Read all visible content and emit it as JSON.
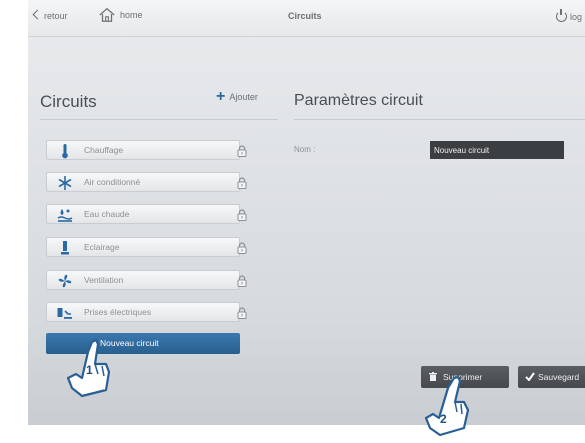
{
  "topbar": {
    "back_label": "retour",
    "home_label": "home",
    "title": "Circuits",
    "logout_label": "log"
  },
  "left": {
    "heading": "Circuits",
    "add_label": "Ajouter",
    "circuits": [
      {
        "label": "Chauffage",
        "icon": "thermometer-icon"
      },
      {
        "label": "Air conditionné",
        "icon": "snowflake-icon"
      },
      {
        "label": "Eau chaude",
        "icon": "water-heater-icon"
      },
      {
        "label": "Eclairage",
        "icon": "lamp-icon"
      },
      {
        "label": "Ventilation",
        "icon": "fan-icon"
      },
      {
        "label": "Prises électriques",
        "icon": "plug-icon"
      }
    ],
    "new_circuit_label": "Nouveau circuit"
  },
  "right": {
    "heading": "Paramètres circuit",
    "name_label": "Nom :",
    "name_value": "Nouveau circuit",
    "delete_label": "Supprimer",
    "save_label": "Sauvegard"
  },
  "callouts": [
    "1",
    "2"
  ],
  "colors": {
    "accent": "#2a69a4",
    "dark_button": "#4d5155",
    "input_bg": "#3c3f42"
  }
}
